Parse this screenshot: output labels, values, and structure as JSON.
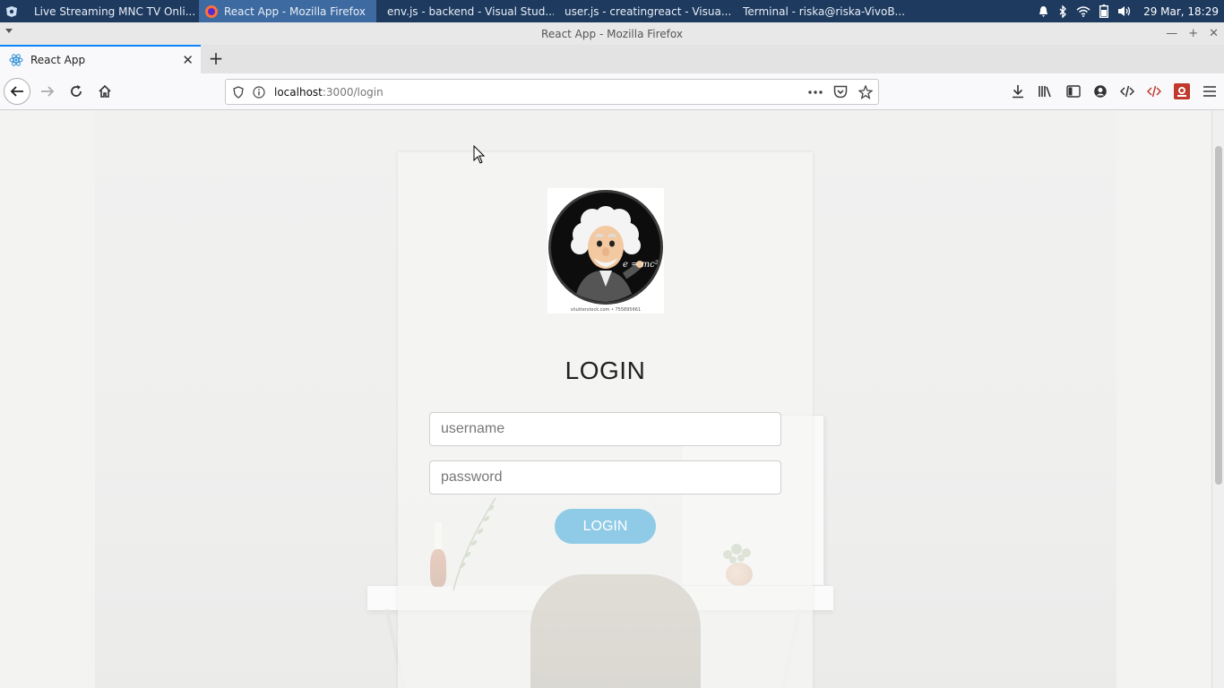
{
  "taskbar": {
    "tasks": [
      {
        "label": "Live Streaming MNC TV Onli...",
        "icon": "firefox-icon"
      },
      {
        "label": "React App - Mozilla Firefox",
        "icon": "firefox-icon"
      },
      {
        "label": "env.js - backend - Visual Stud...",
        "icon": "vscode-icon"
      },
      {
        "label": "user.js - creatingreact - Visua...",
        "icon": "vscode-icon"
      },
      {
        "label": "Terminal - riska@riska-VivoB...",
        "icon": "terminal-icon"
      }
    ],
    "clock": "29 Mar, 18:29"
  },
  "window": {
    "title": "React App - Mozilla Firefox"
  },
  "browser": {
    "tab_title": "React App",
    "url_host": "localhost",
    "url_path": ":3000/login"
  },
  "login": {
    "heading": "LOGIN",
    "username_placeholder": "username",
    "password_placeholder": "password",
    "button_label": "LOGIN",
    "avatar_caption": "shutterstock.com • 755895661",
    "avatar_formula": "e = mc²"
  },
  "colors": {
    "taskbar_bg": "#1e3a5f",
    "active_task_bg": "#3d6aa0",
    "accent": "#0a84ff",
    "login_button_bg": "#8fcbe6"
  }
}
